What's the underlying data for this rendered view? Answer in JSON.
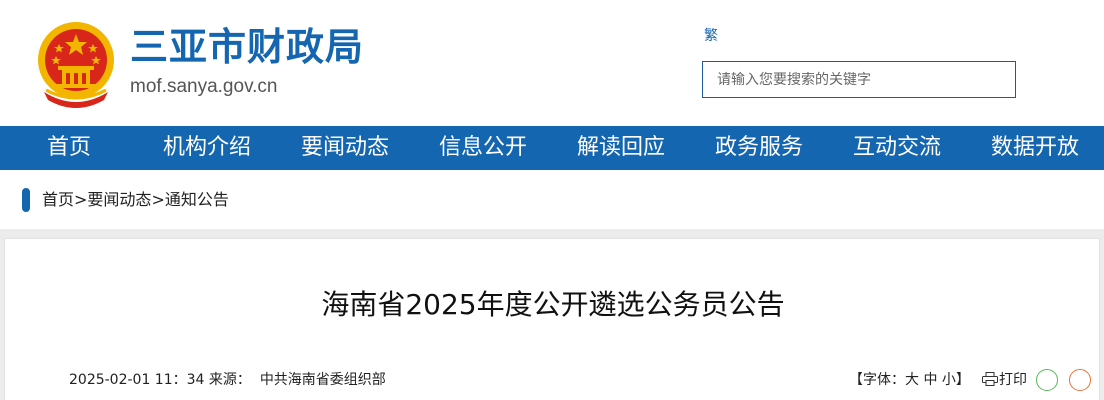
{
  "header": {
    "site_title": "三亚市财政局",
    "site_domain": "mof.sanya.gov.cn",
    "traditional_link": "繁",
    "search_placeholder": "请输入您要搜索的关键字"
  },
  "nav": {
    "items": [
      "首页",
      "机构介绍",
      "要闻动态",
      "信息公开",
      "解读回应",
      "政务服务",
      "互动交流",
      "数据开放"
    ]
  },
  "breadcrumb": {
    "items": [
      "首页",
      "要闻动态",
      "通知公告"
    ],
    "separator": ">"
  },
  "article": {
    "title": "海南省2025年度公开遴选公务员公告",
    "date": "2025-02-01 11：34",
    "source_label": "来源：",
    "source": "中共海南省委组织部",
    "font_size_label": "【字体：",
    "font_size_options": [
      "大",
      "中",
      "小"
    ],
    "font_size_close": "】",
    "print_label": "打印"
  },
  "colors": {
    "brand_blue": "#1566b0",
    "emblem_red": "#d8261a",
    "emblem_gold": "#f2b600"
  },
  "icons": {
    "emblem": "national-emblem-icon",
    "print": "printer-icon",
    "share_green": "wechat-share-icon",
    "share_orange": "weibo-share-icon"
  }
}
